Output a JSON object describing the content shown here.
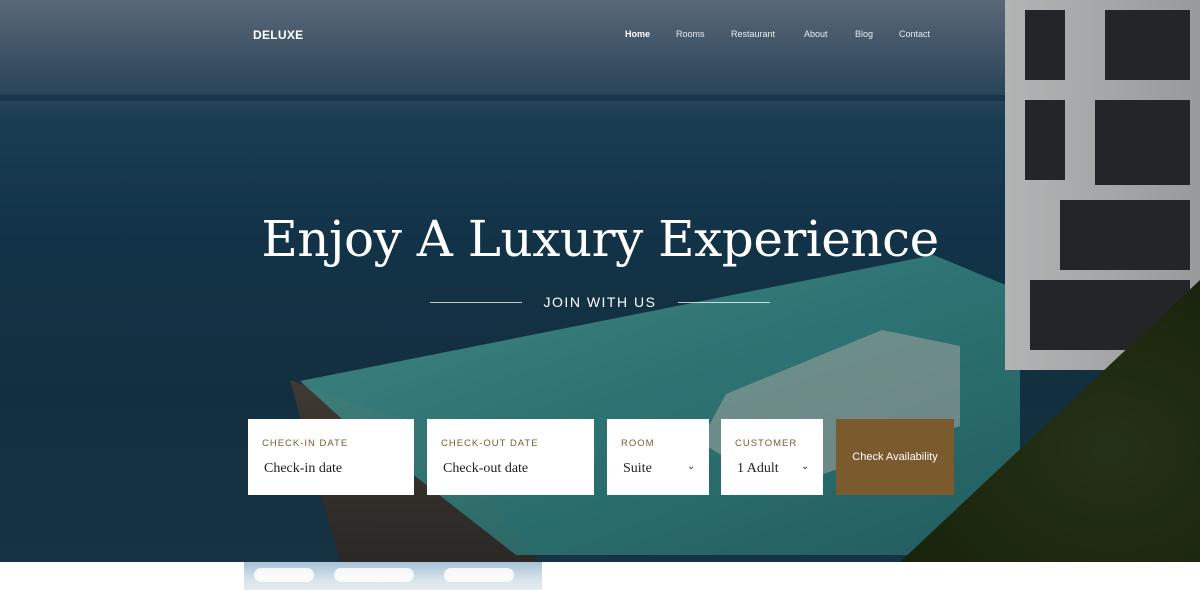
{
  "brand": {
    "logo": "DELUXE"
  },
  "nav": {
    "items": [
      {
        "label": "Home",
        "active": true
      },
      {
        "label": "Rooms",
        "active": false
      },
      {
        "label": "Restaurant",
        "active": false
      },
      {
        "label": "About",
        "active": false
      },
      {
        "label": "Blog",
        "active": false
      },
      {
        "label": "Contact",
        "active": false
      }
    ]
  },
  "hero": {
    "title": "Enjoy A Luxury Experience",
    "subtitle": "JOIN WITH US"
  },
  "booking": {
    "checkin": {
      "label": "CHECK-IN DATE",
      "value": "Check-in date"
    },
    "checkout": {
      "label": "CHECK-OUT DATE",
      "value": "Check-out date"
    },
    "room": {
      "label": "ROOM",
      "value": "Suite"
    },
    "customer": {
      "label": "CUSTOMER",
      "value": "1 Adult"
    },
    "button": "Check Availability",
    "icons": {
      "dropdown": "chevron-down-icon"
    },
    "colors": {
      "accent": "#7b5a2e",
      "label": "#7a5a33"
    }
  }
}
